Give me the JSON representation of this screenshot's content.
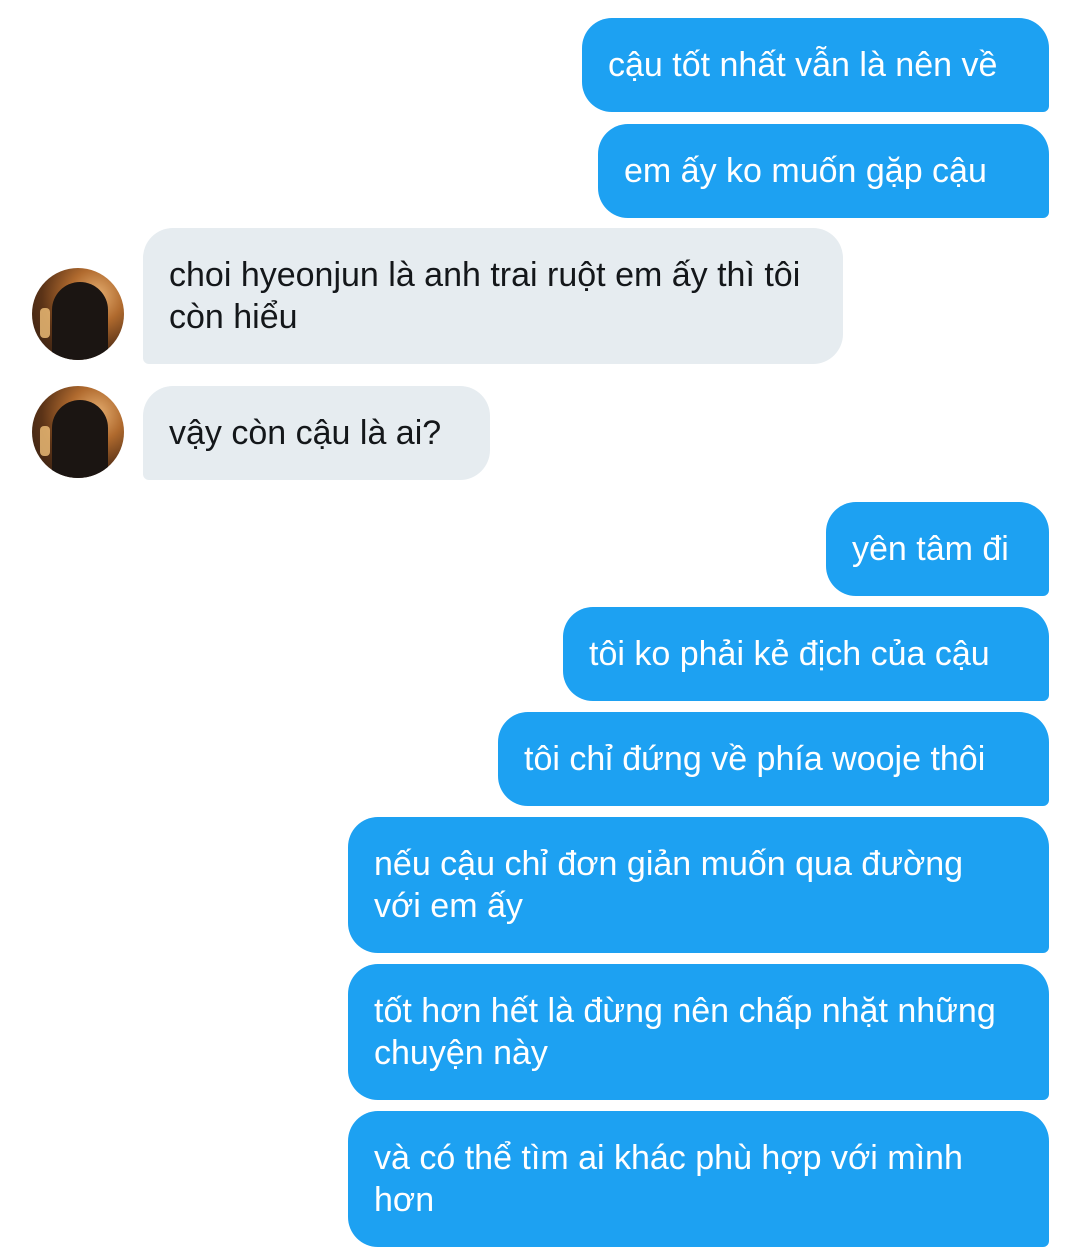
{
  "messages": [
    {
      "side": "out",
      "text": "cậu tốt nhất vẫn là nên về"
    },
    {
      "side": "out",
      "text": "em ấy ko muốn gặp cậu"
    },
    {
      "side": "in",
      "text": "choi hyeonjun là anh trai ruột em ấy thì tôi còn hiểu"
    },
    {
      "side": "in",
      "text": "vậy còn cậu là ai?"
    },
    {
      "side": "out",
      "text": "yên tâm đi"
    },
    {
      "side": "out",
      "text": "tôi ko phải kẻ địch của cậu"
    },
    {
      "side": "out",
      "text": "tôi chỉ đứng về phía wooje thôi"
    },
    {
      "side": "out",
      "text": "nếu cậu chỉ đơn giản muốn qua đường với em ấy"
    },
    {
      "side": "out",
      "text": "tốt hơn hết là đừng nên chấp nhặt những chuyện này"
    },
    {
      "side": "out",
      "text": "và có thể tìm ai khác phù hợp với mình hơn"
    }
  ],
  "colors": {
    "outgoing_bubble": "#1da1f2",
    "incoming_bubble": "#e6ecf0",
    "outgoing_text": "#ffffff",
    "incoming_text": "#14171a"
  },
  "icons": {
    "avatar": "user-avatar-photo"
  }
}
